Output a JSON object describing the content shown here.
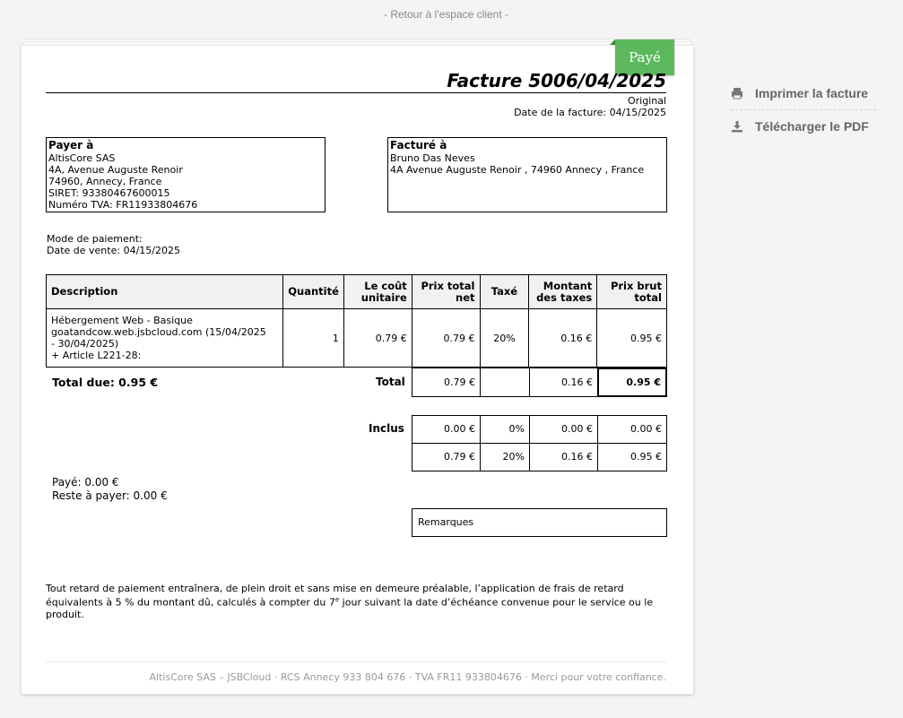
{
  "nav": {
    "back_link": "- Retour à l'espace client -"
  },
  "status": {
    "badge": "Payé"
  },
  "invoice": {
    "title": "Facture 5006/04/2025",
    "copy_label": "Original",
    "date_line": "Date de la facture: 04/15/2025"
  },
  "payee": {
    "heading": "Payer à",
    "lines": [
      "AltisCore SAS",
      "4A, Avenue Auguste Renoir",
      "74960, Annecy, France",
      "SIRET: 93380467600015",
      "Numéro TVA: FR11933804676"
    ]
  },
  "billed": {
    "heading": "Facturé à",
    "lines": [
      "Bruno Das Neves",
      "4A Avenue Auguste Renoir , 74960 Annecy , France"
    ]
  },
  "payment": {
    "mode": "Mode de paiement:",
    "sale_date": "Date de vente: 04/15/2025"
  },
  "table": {
    "headers": {
      "description": "Description",
      "quantity": "Quantité",
      "unit_cost": "Le coût unitaire",
      "net_total": "Prix total net",
      "taxed": "Taxé",
      "tax_amount": "Montant des taxes",
      "gross_total": "Prix brut total"
    },
    "rows": [
      {
        "description_l1": "Hébergement Web - Basique",
        "description_l2": "goatandcow.web.jsbcloud.com (15/04/2025",
        "description_l3": "- 30/04/2025)",
        "description_l4": "+ Article L221-28:",
        "quantity": "1",
        "unit_cost": "0.79 €",
        "net_total": "0.79 €",
        "taxed": "20%",
        "tax_amount": "0.16 €",
        "gross_total": "0.95 €"
      }
    ]
  },
  "totals": {
    "total_due": "Total due: 0.95 €",
    "label": "Total",
    "net": "0.79 €",
    "tax": "0.16 €",
    "gross": "0.95 €"
  },
  "included": {
    "label": "Inclus",
    "rows": [
      {
        "net": "0.00 €",
        "rate": "0%",
        "tax": "0.00 €",
        "gross": "0.00 €"
      },
      {
        "net": "0.79 €",
        "rate": "20%",
        "tax": "0.16 €",
        "gross": "0.95 €"
      }
    ]
  },
  "balance": {
    "paid": "Payé: 0.00 €",
    "remaining": "Reste à payer: 0.00 €"
  },
  "remarks": {
    "label": "Remarques"
  },
  "legal": {
    "line1": "Tout retard de paiement entraînera, de plein droit et sans mise en demeure préalable, l’application de frais de retard",
    "line2a": "équivalents à 5 % du montant dû, calculés à compter du 7",
    "line2sup": "e",
    "line2b": " jour suivant la date d’échéance convenue pour le service ou le",
    "line3": "produit."
  },
  "footer": {
    "text": "AltisCore SAS – JSBCloud · RCS Annecy 933 804 676 · TVA FR11 933804676 · Merci pour votre confiance."
  },
  "actions": {
    "print": {
      "label": "Imprimer la facture",
      "icon": "print-icon"
    },
    "download": {
      "label": "Télécharger le PDF",
      "icon": "download-icon"
    }
  },
  "colors": {
    "paid_badge": "#5cb85c",
    "side_text": "#666666",
    "back_link": "#888888"
  }
}
